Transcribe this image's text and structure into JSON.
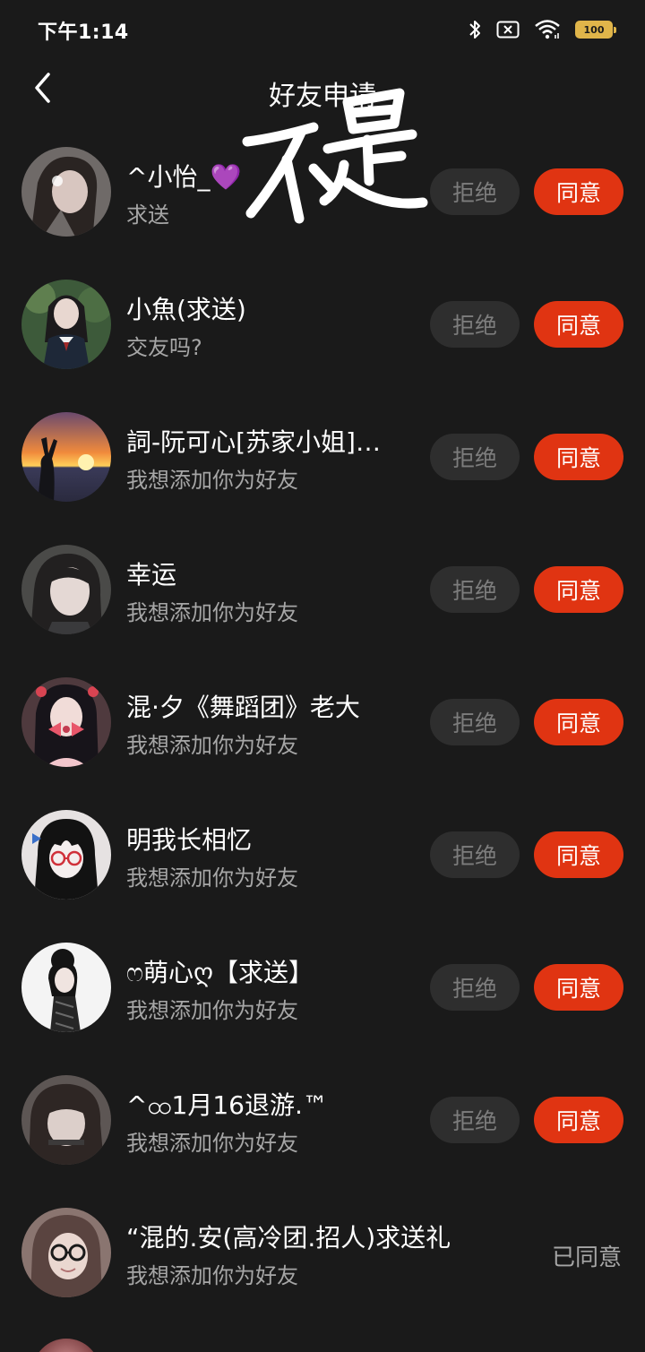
{
  "status_bar": {
    "time": "下午1:14",
    "battery": "100",
    "icons": [
      "bluetooth-icon",
      "no-sim-icon",
      "wifi-icon",
      "battery-icon"
    ]
  },
  "header": {
    "title": "好友申请",
    "back_icon": "chevron-left-icon"
  },
  "annotation": {
    "text": "不是"
  },
  "buttons": {
    "reject": "拒绝",
    "accept": "同意"
  },
  "requests": [
    {
      "name": "^小怡_💜",
      "message": "求送",
      "status": "pending"
    },
    {
      "name": "小魚(求送)",
      "message": "交友吗?",
      "status": "pending"
    },
    {
      "name": "詞-阮可心[苏家小姐]…",
      "message": "我想添加你为好友",
      "status": "pending"
    },
    {
      "name": "幸运",
      "message": "我想添加你为好友",
      "status": "pending"
    },
    {
      "name": "混·夕《舞蹈团》老大",
      "message": "我想添加你为好友",
      "status": "pending"
    },
    {
      "name": "明我长相忆",
      "message": "我想添加你为好友",
      "status": "pending"
    },
    {
      "name": "ෆ萌心ღ【求送】",
      "message": "我想添加你为好友",
      "status": "pending"
    },
    {
      "name": "^ထ1月16退游.™",
      "message": "我想添加你为好友",
      "status": "pending"
    },
    {
      "name": "“混的.安(高冷团.招人)求送礼",
      "message": "我想添加你为好友",
      "status": "agreed",
      "status_text": "已同意"
    }
  ],
  "colors": {
    "background": "#1a1a1a",
    "accept": "#e03412",
    "reject_bg": "#2e2e2e",
    "secondary_text": "#a6a6a6",
    "battery": "#e0b54a"
  }
}
